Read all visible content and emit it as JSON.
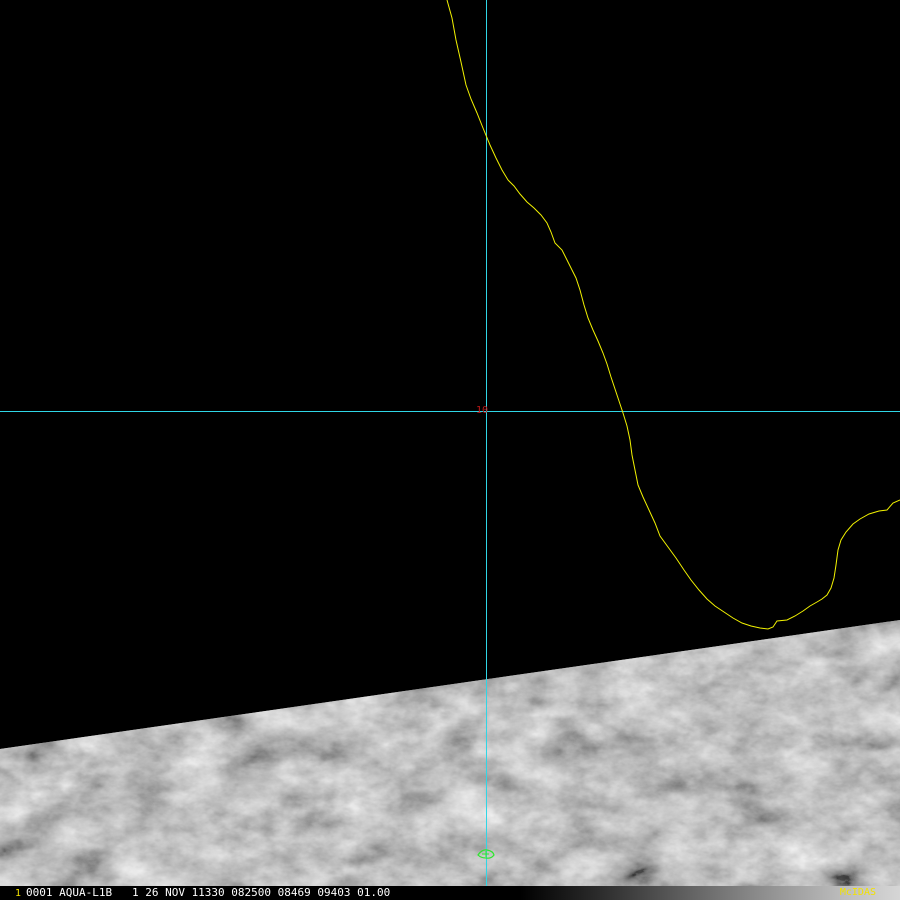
{
  "map": {
    "grid_label": "10",
    "colors": {
      "coastline": "#f2f200",
      "gridline": "#2fd6e6",
      "grid_label": "#c01818",
      "cursor": "#2ee62e",
      "background": "#000000"
    }
  },
  "status_bar": {
    "frame_number": "1",
    "text": "0001 AQUA-L1B   1 26 NOV 11330 082500 08469 09403 01.00",
    "brand": "McIDAS",
    "brand_color": "#f2e200"
  }
}
